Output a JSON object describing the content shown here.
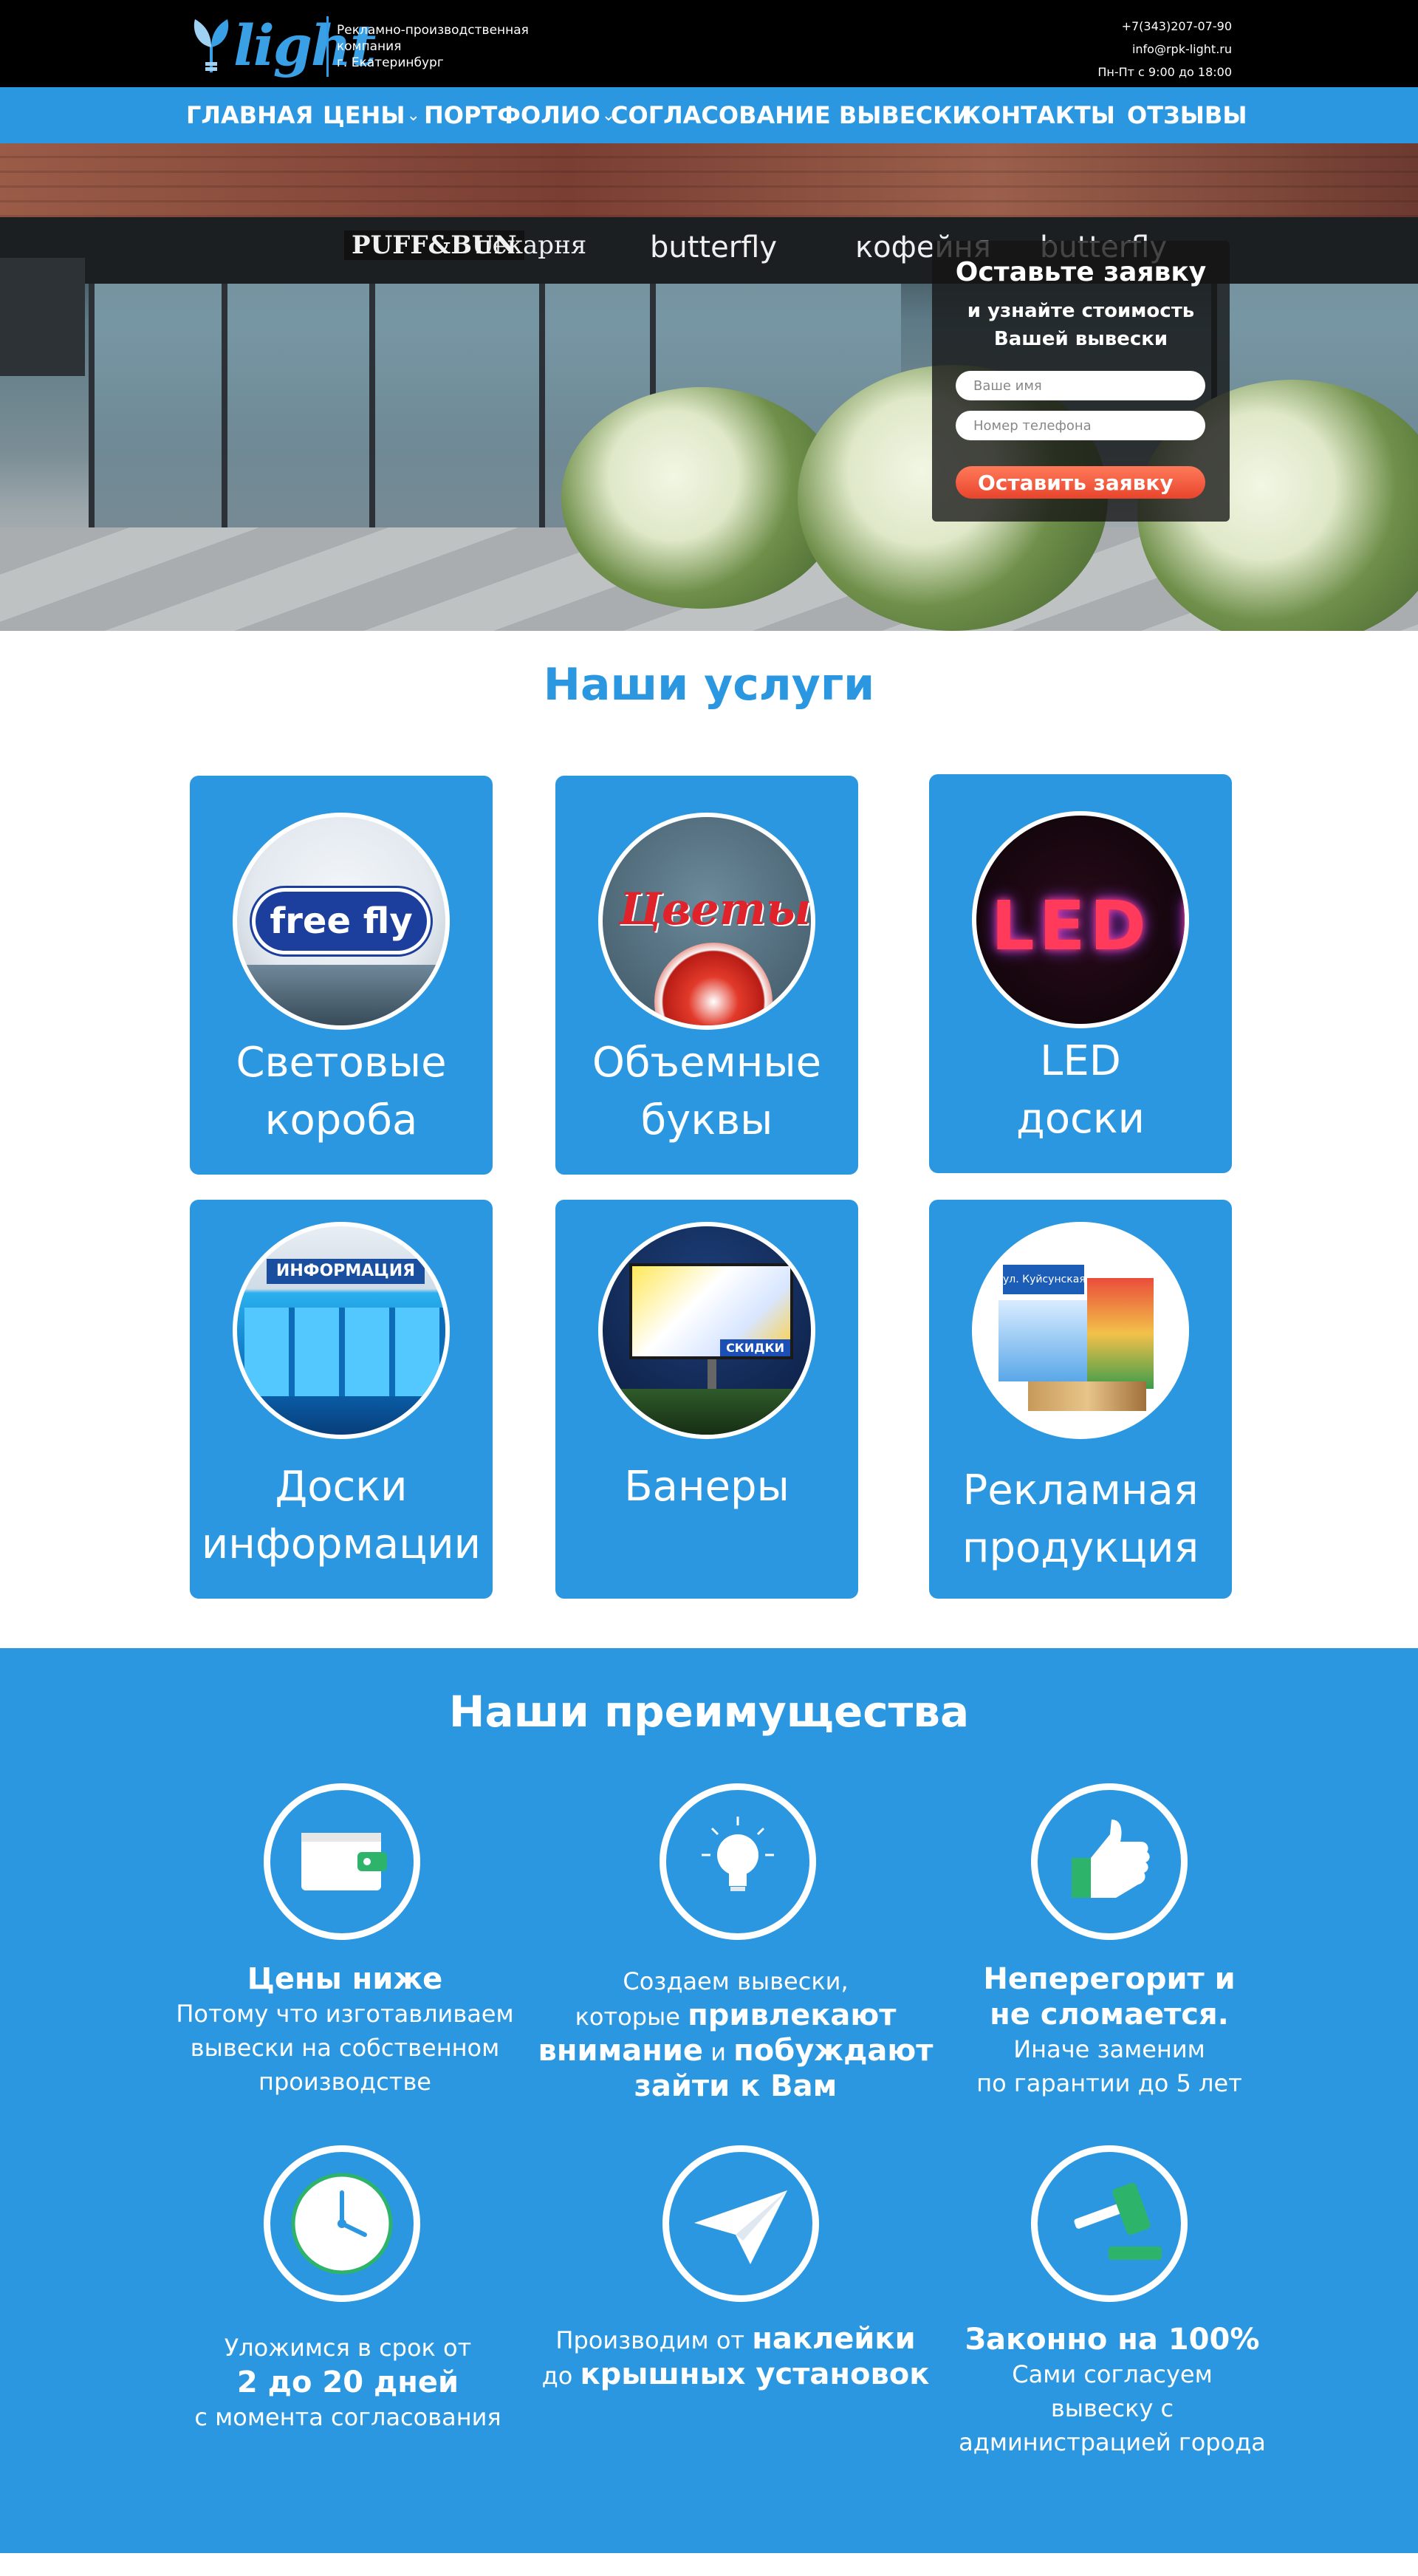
{
  "header": {
    "logo_text": "light",
    "company_line1": "Рекламно-производственная",
    "company_line2": "компания",
    "company_line3": "г. Екатеринбург",
    "phone": "+7(343)207-07-90",
    "email": "info@rpk-light.ru",
    "hours": "Пн-Пт с 9:00 до 18:00"
  },
  "nav": {
    "items": [
      {
        "label": "ГЛАВНАЯ"
      },
      {
        "label": "ЦЕНЫ"
      },
      {
        "label": "ПОРТФОЛИО"
      },
      {
        "label": "СОГЛАСОВАНИЕ ВЫВЕСКИ"
      },
      {
        "label": "КОНТАКТЫ"
      },
      {
        "label": "ОТЗЫВЫ"
      }
    ]
  },
  "hero": {
    "signs": [
      "PUFF&BUN",
      "пекарня",
      "butterfly",
      "кофейня",
      "butterfly"
    ],
    "form": {
      "title": "Оставьте заявку",
      "subtitle_line1": "и узнайте стоимость",
      "subtitle_line2": "Вашей вывески",
      "name_placeholder": "Ваше имя",
      "phone_placeholder": "Номер телефона",
      "submit_label": "Оставить заявку"
    }
  },
  "services": {
    "title": "Наши услуги",
    "cards": [
      {
        "line1": "Световые",
        "line2": "короба",
        "image_text": "free fly"
      },
      {
        "line1": "Объемные",
        "line2": "буквы",
        "image_text": "Цветы"
      },
      {
        "line1": "LED",
        "line2": "доски",
        "image_text": "LED D"
      },
      {
        "line1": "Доски",
        "line2": "информации",
        "image_text": "ИНФОРМАЦИЯ"
      },
      {
        "line1": "Банеры",
        "line2": "",
        "image_text": "СКИДКИ"
      },
      {
        "line1": "Рекламная",
        "line2": "продукция",
        "image_text": "ул. Куйсунская"
      }
    ]
  },
  "advantages": {
    "title": "Наши преимущества",
    "items": [
      {
        "icon": "wallet-icon",
        "a": "Цены ниже",
        "b": "Потому что изготавливаем",
        "c": "вывески на собственном",
        "d": "производстве"
      },
      {
        "icon": "lightbulb-icon",
        "a": "Создаем вывески,",
        "b": "которые",
        "c": "привлекают",
        "d": "внимание",
        "e": "и",
        "f": "побуждают",
        "g": "зайти к Вам"
      },
      {
        "icon": "thumbs-up-icon",
        "a": "Неперегорит и",
        "b": "не сломается.",
        "c": "Иначе заменим",
        "d": "по гарантии до 5 лет"
      },
      {
        "icon": "clock-icon",
        "a": "Уложимся в срок от",
        "b": "2 до 20 дней",
        "c": "с момента согласования"
      },
      {
        "icon": "paper-plane-icon",
        "a": "Производим от",
        "b": "наклейки",
        "c": "до",
        "d": "крышных установок"
      },
      {
        "icon": "gavel-icon",
        "a": "Законно на 100%",
        "b": "Сами согласуем",
        "c": "вывеску с",
        "d": "администрацией города"
      }
    ]
  },
  "colors": {
    "primary": "#2a97e0",
    "header_bg": "#000000",
    "cta": "#e8452c"
  }
}
